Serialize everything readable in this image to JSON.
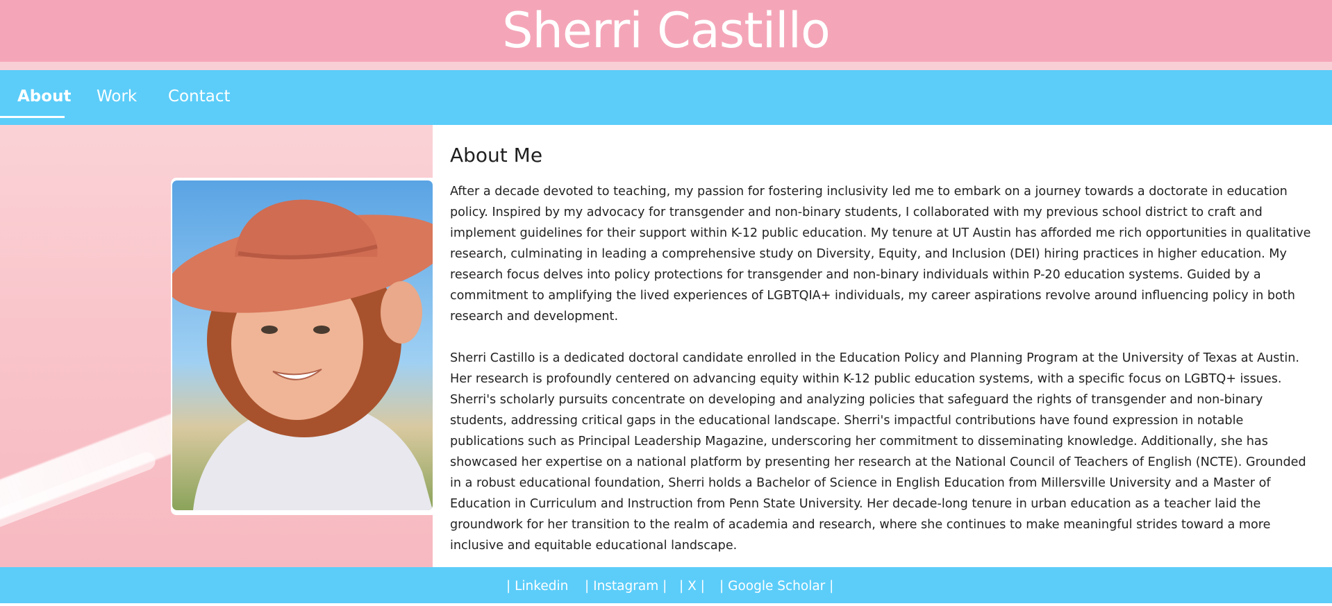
{
  "header": {
    "title": "Sherri Castillo"
  },
  "nav": {
    "items": [
      {
        "label": "About",
        "active": true
      },
      {
        "label": "Work",
        "active": false
      },
      {
        "label": "Contact",
        "active": false
      }
    ]
  },
  "about": {
    "heading": "About Me",
    "paragraph1": "After a decade devoted to teaching, my passion for fostering inclusivity led me to embark on a journey towards a doctorate in education policy. Inspired by my advocacy for transgender and non-binary students, I collaborated with my previous school district to craft and implement guidelines for their support within K-12 public education. My tenure at UT Austin has afforded me rich opportunities in qualitative research, culminating in leading a comprehensive study on Diversity, Equity, and Inclusion (DEI) hiring practices in higher education. My research focus delves into policy protections for transgender and non-binary individuals within P-20 education systems. Guided by a commitment to amplifying the lived experiences of LGBTQIA+ individuals, my career aspirations revolve around influencing policy in both research and development.",
    "paragraph2": "Sherri Castillo is a dedicated doctoral candidate enrolled in the Education Policy and Planning Program at the University of Texas at Austin. Her research is profoundly centered on advancing equity within K-12 public education systems, with a specific focus on LGBTQ+ issues. Sherri's scholarly pursuits concentrate on developing and analyzing policies that safeguard the rights of transgender and non-binary students, addressing critical gaps in the educational landscape. Sherri's impactful contributions have found expression in notable publications such as Principal Leadership Magazine, underscoring her commitment to disseminating knowledge. Additionally, she has showcased her expertise on a national platform by presenting her research at the National Council of Teachers of English (NCTE). Grounded in a robust educational foundation, Sherri holds a Bachelor of Science in English Education from Millersville University and a Master of Education in Curriculum and Instruction from Penn State University. Her decade-long tenure in urban education as a teacher laid the groundwork for her transition to the realm of academia and research, where she continues to make meaningful strides toward a more inclusive and equitable educational landscape."
  },
  "footer": {
    "links": [
      {
        "label": "| Linkedin"
      },
      {
        "label": "| Instagram |"
      },
      {
        "label": "| X |"
      },
      {
        "label": "| Google Scholar |"
      }
    ]
  },
  "colors": {
    "header_bg": "#f4a6b8",
    "nav_bg": "#5ccdf9",
    "footer_bg": "#5ccdf9",
    "panel_pink": "#f9c5cb"
  },
  "icons": {
    "portrait": "profile-photo"
  }
}
